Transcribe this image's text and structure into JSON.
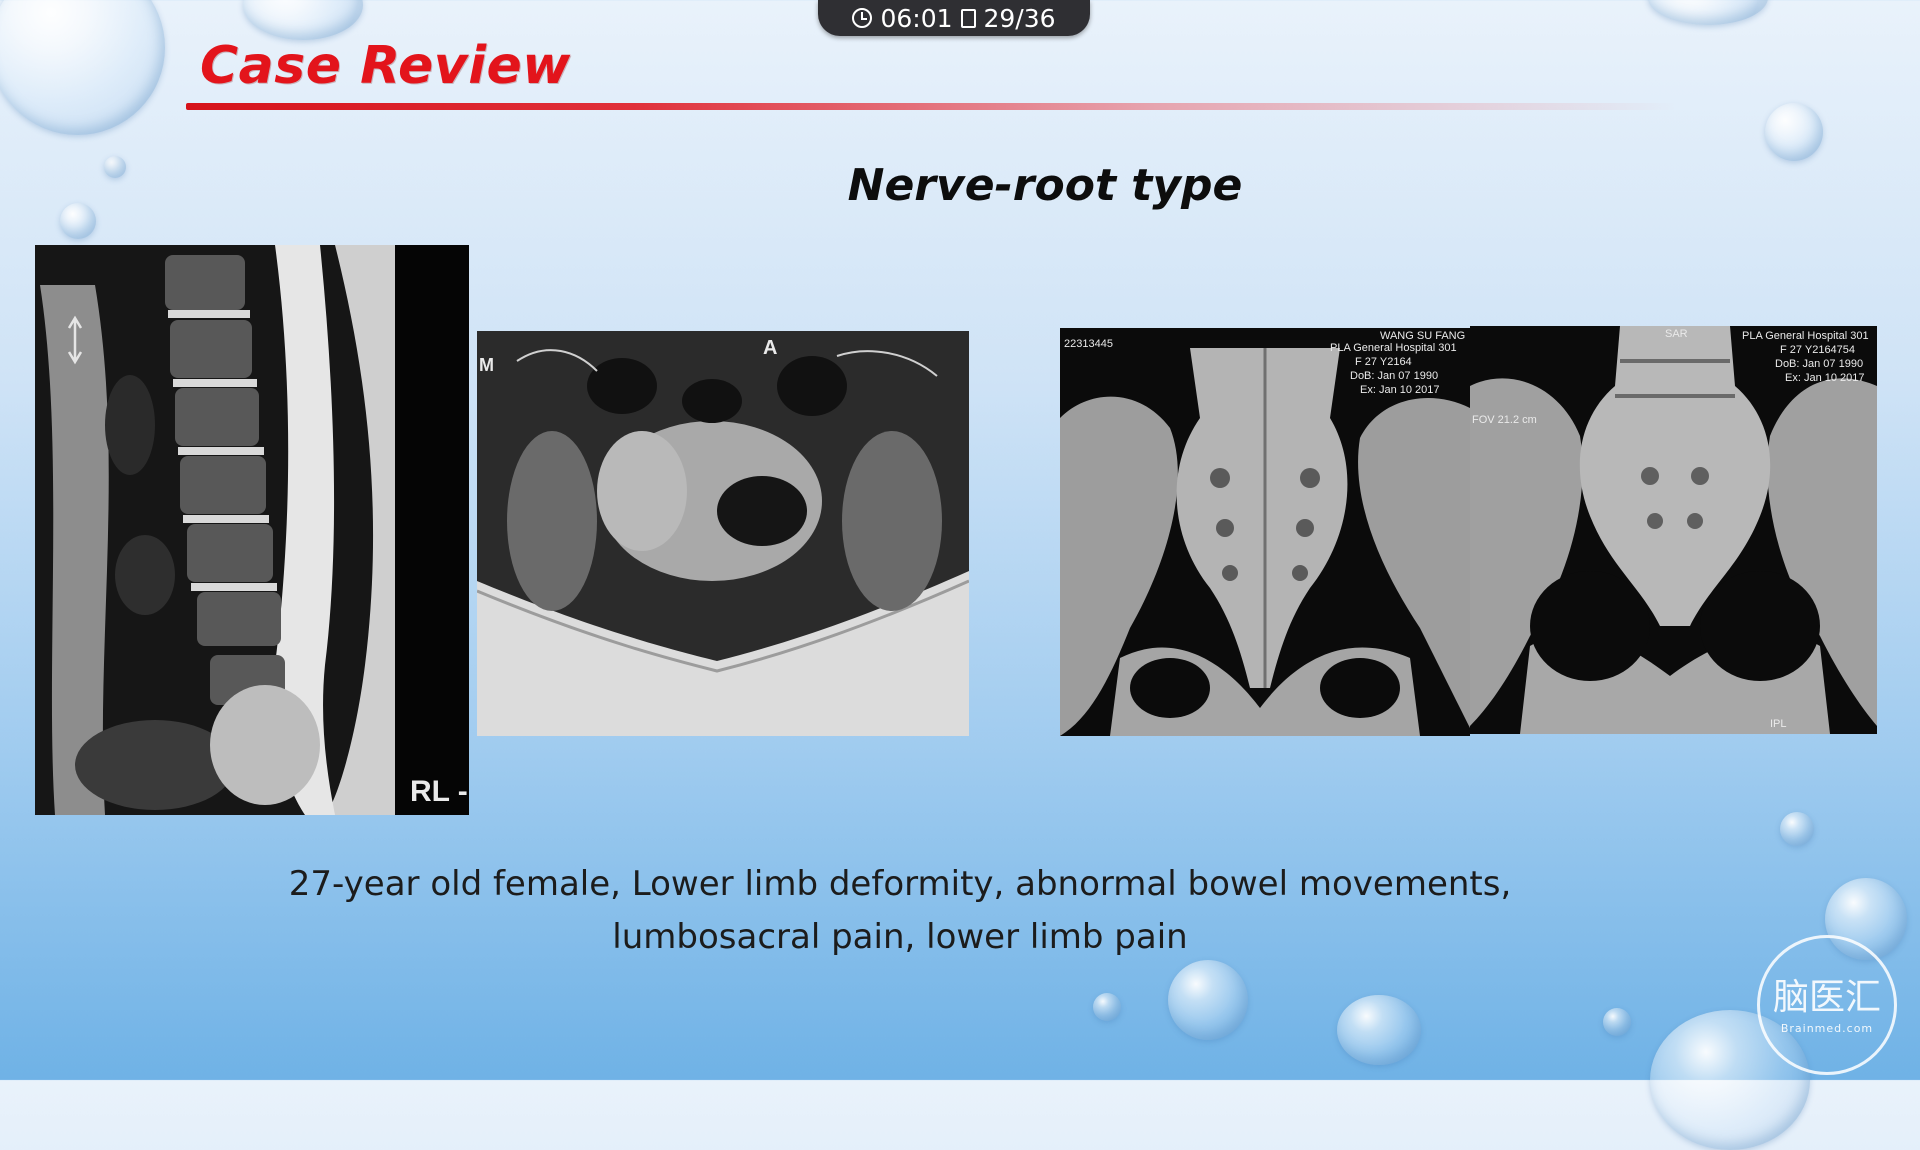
{
  "player": {
    "elapsed": "06:01",
    "slide_counter": "29/36",
    "clock_icon": "clock-icon",
    "slide_icon": "slide-icon"
  },
  "slide": {
    "section_title": "Case Review",
    "subtitle": "Nerve-root type",
    "caption_line1": "27-year old female, Lower limb deformity, abnormal bowel movements,",
    "caption_line2": "lumbosacral pain, lower limb pain",
    "accent_color": "#e3141b"
  },
  "images": {
    "mri_sagittal": {
      "label": "RL -"
    },
    "mri_axial": {
      "label_anterior": "A",
      "label_side": "M"
    },
    "ct_posterior": {
      "text_id": "22313445",
      "text_name": "WANG SU FANG",
      "text_hospital": "PLA General Hospital 301",
      "text_patient": "F 27 Y2164",
      "text_dob": "DoB: Jan 07 1990",
      "text_exam": "Ex: Jan 10 2017"
    },
    "ct_anterior": {
      "text_hospital": "PLA General Hospital 301",
      "text_patient": "F 27 Y2164754",
      "text_dob": "DoB: Jan 07 1990",
      "text_exam": "Ex: Jan 10 2017",
      "text_fov": "FOV 21.2 cm",
      "text_orient": "SAR",
      "text_bottom": "IPL"
    }
  },
  "watermark": {
    "main": "脑医汇",
    "sub": "Brainmed.com"
  }
}
